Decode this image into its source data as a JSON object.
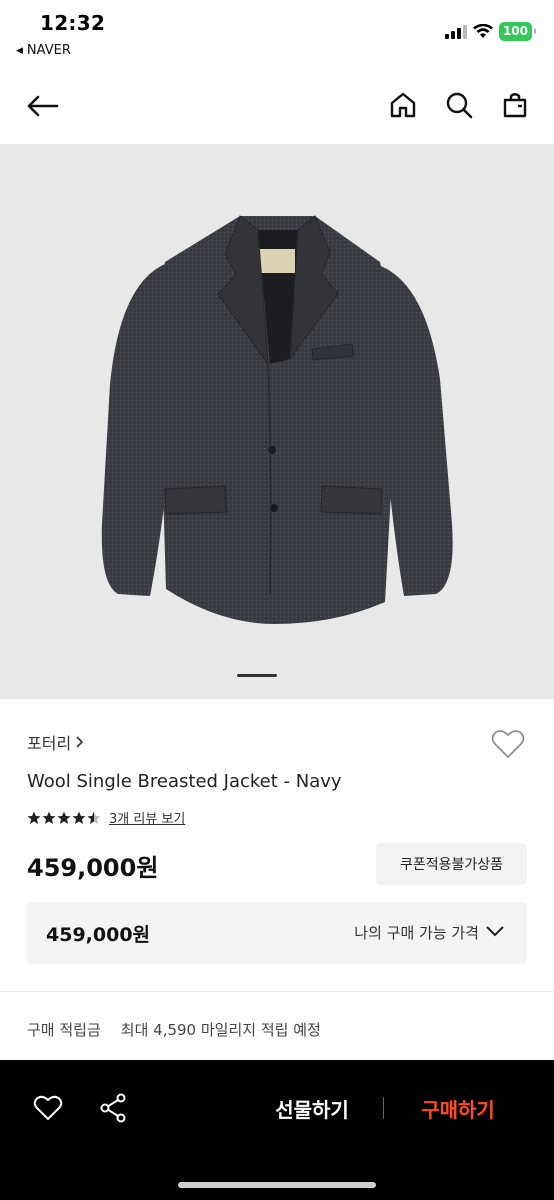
{
  "status_bar": {
    "time": "12:32",
    "back_app": "NAVER",
    "battery": "100"
  },
  "header": {
    "icons": [
      "back-arrow-icon",
      "home-icon",
      "search-icon",
      "shopping-bag-icon"
    ]
  },
  "product": {
    "brand": "포터리",
    "name": "Wool Single Breasted Jacket - Navy",
    "rating": 4.5,
    "review_link": "3개 리뷰 보기",
    "price": "459,000원",
    "coupon_badge": "쿠폰적용불가상품",
    "image_index": 1
  },
  "price_box": {
    "value": "459,000원",
    "label": "나의 구매 가능 가격"
  },
  "points": {
    "label": "구매 적립금",
    "value": "최대 4,590 마일리지 적립 예정"
  },
  "bottom_bar": {
    "gift_label": "선물하기",
    "buy_label": "구매하기",
    "buy_color": "#ff4c1f"
  }
}
